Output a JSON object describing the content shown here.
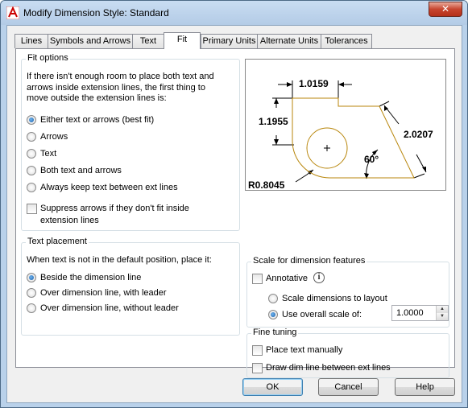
{
  "window": {
    "title": "Modify Dimension Style: Standard",
    "close_glyph": "✕"
  },
  "tabs": [
    {
      "label": "Lines"
    },
    {
      "label": "Symbols and Arrows"
    },
    {
      "label": "Text"
    },
    {
      "label": "Fit"
    },
    {
      "label": "Primary Units"
    },
    {
      "label": "Alternate Units"
    },
    {
      "label": "Tolerances"
    }
  ],
  "active_tab": "Fit",
  "fit_options": {
    "title": "Fit options",
    "description_lines": [
      "If there isn't enough room to place both text and",
      "arrows inside extension lines, the first thing to",
      "move outside the extension lines is:"
    ],
    "radios": [
      {
        "label": "Either text or arrows (best fit)",
        "checked": true
      },
      {
        "label": "Arrows",
        "checked": false
      },
      {
        "label": "Text",
        "checked": false
      },
      {
        "label": "Both text and arrows",
        "checked": false
      },
      {
        "label": "Always keep text between ext lines",
        "checked": false
      }
    ],
    "suppress": {
      "line1": "Suppress arrows if they don't fit inside",
      "line2": "extension lines",
      "checked": false
    }
  },
  "text_placement": {
    "title": "Text placement",
    "description": "When text is not in the default position, place it:",
    "radios": [
      {
        "label": "Beside the dimension line",
        "checked": true
      },
      {
        "label": "Over dimension line, with leader",
        "checked": false
      },
      {
        "label": "Over dimension line, without leader",
        "checked": false
      }
    ]
  },
  "preview": {
    "dim_top": "1.0159",
    "dim_left": "1.1955",
    "dim_right": "2.0207",
    "angle": "60°",
    "radius": "R0.8045",
    "line_color": "#b8860b"
  },
  "scale": {
    "title": "Scale for dimension features",
    "annotative_label": "Annotative",
    "annotative_checked": false,
    "info_glyph": "i",
    "layout_label": "Scale dimensions to layout",
    "overall_label": "Use overall scale of:",
    "overall_value": "1.0000",
    "selected": "overall"
  },
  "fine_tuning": {
    "title": "Fine tuning",
    "place_manual": "Place text manually",
    "draw_dim_line": "Draw dim line between ext lines"
  },
  "buttons": {
    "ok": "OK",
    "cancel": "Cancel",
    "help": "Help"
  },
  "spin_up": "▲",
  "spin_down": "▼"
}
